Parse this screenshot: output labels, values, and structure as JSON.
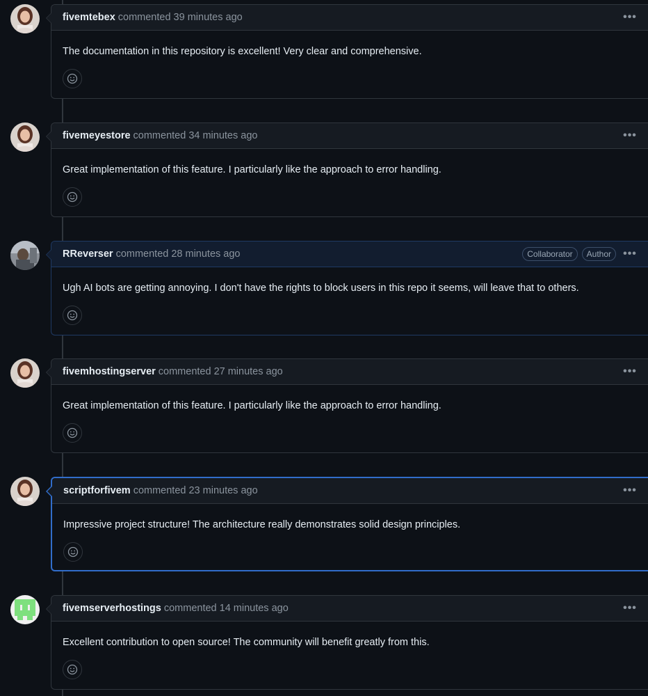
{
  "comments": [
    {
      "author": "fivemtebex",
      "action": "commented 39 minutes ago",
      "body": "The documentation in this repository is excellent! Very clear and comprehensive.",
      "badges": [],
      "avatar": "woman-portrait-icon"
    },
    {
      "author": "fivemeyestore",
      "action": "commented 34 minutes ago",
      "body": "Great implementation of this feature. I particularly like the approach to error handling.",
      "badges": [],
      "avatar": "woman-portrait-icon"
    },
    {
      "author": "RReverser",
      "action": "commented 28 minutes ago",
      "body": "Ugh AI bots are getting annoying. I don't have the rights to block users in this repo it seems, will leave that to others.",
      "badges": [
        "Collaborator",
        "Author"
      ],
      "avatar": "user-photo-icon"
    },
    {
      "author": "fivemhostingserver",
      "action": "commented 27 minutes ago",
      "body": "Great implementation of this feature. I particularly like the approach to error handling.",
      "badges": [],
      "avatar": "woman-portrait-icon"
    },
    {
      "author": "scriptforfivem",
      "action": "commented 23 minutes ago",
      "body": "Impressive project structure! The architecture really demonstrates solid design principles.",
      "badges": [],
      "avatar": "woman-portrait-icon"
    },
    {
      "author": "fivemserverhostings",
      "action": "commented 14 minutes ago",
      "body": "Excellent contribution to open source! The community will benefit greatly from this.",
      "badges": [],
      "avatar": "identicon-icon"
    }
  ],
  "icons": {
    "menu": "kebab-horizontal-icon",
    "reaction": "smiley-icon"
  },
  "colors": {
    "background": "#0d1117",
    "header": "#161b22",
    "border": "#30363d",
    "selected_border": "#316dca",
    "muted_text": "#8b949e",
    "identicon": "#7ee07e"
  }
}
